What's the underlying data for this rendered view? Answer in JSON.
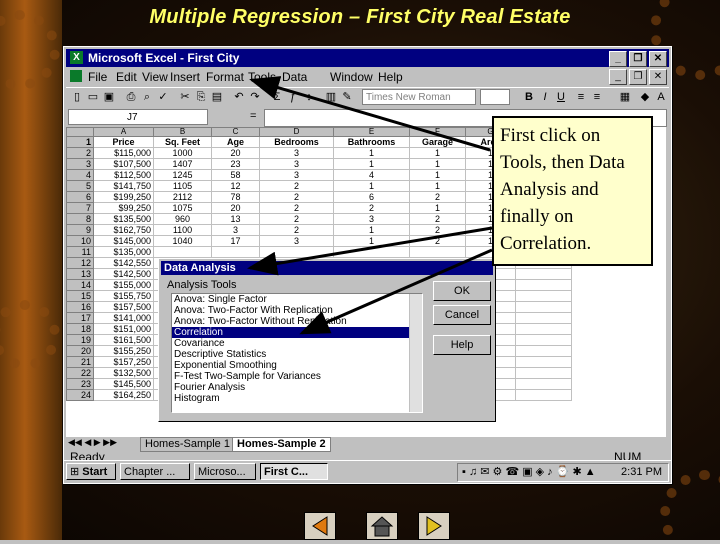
{
  "slide": {
    "title": "Multiple Regression –   First City Real Estate"
  },
  "excel": {
    "window_title": "Microsoft Excel - First City",
    "menu": [
      "File",
      "Edit",
      "View",
      "Insert",
      "Format",
      "Tools",
      "Data",
      "Window",
      "Help"
    ],
    "font_name": "Times New Roman",
    "cell_ref": "J7",
    "columns": [
      "A",
      "B",
      "C",
      "D",
      "E",
      "F",
      "G"
    ],
    "headers": [
      "Price",
      "Sq. Feet",
      "Age",
      "Bedrooms",
      "Bathrooms",
      "Garage",
      "Area"
    ],
    "rows": [
      [
        "$115,000",
        "1000",
        "20",
        "3",
        "1",
        "1",
        "1"
      ],
      [
        "$107,500",
        "1407",
        "23",
        "3",
        "1",
        "1",
        "1"
      ],
      [
        "$112,500",
        "1245",
        "58",
        "3",
        "4",
        "1",
        "1"
      ],
      [
        "$141,750",
        "1105",
        "12",
        "2",
        "1",
        "1",
        "1"
      ],
      [
        "$199,250",
        "2112",
        "78",
        "2",
        "6",
        "2",
        "1"
      ],
      [
        "$99,250",
        "1075",
        "20",
        "2",
        "2",
        "1",
        "1"
      ],
      [
        "$135,500",
        "960",
        "13",
        "2",
        "3",
        "2",
        "1"
      ],
      [
        "$162,750",
        "1100",
        "3",
        "2",
        "1",
        "2",
        "1"
      ],
      [
        "$145,000",
        "1040",
        "17",
        "3",
        "1",
        "2",
        "1"
      ],
      [
        "$135,000",
        "",
        "",
        "",
        "",
        "",
        ""
      ],
      [
        "$142,550",
        "",
        "",
        "",
        "",
        "",
        ""
      ],
      [
        "$142,500",
        "",
        "",
        "",
        "",
        "",
        ""
      ],
      [
        "$155,000",
        "",
        "",
        "",
        "",
        "",
        ""
      ],
      [
        "$155,750",
        "",
        "",
        "",
        "",
        "",
        ""
      ],
      [
        "$157,500",
        "",
        "",
        "",
        "",
        "",
        ""
      ],
      [
        "$141,000",
        "",
        "",
        "",
        "",
        "",
        ""
      ],
      [
        "$151,000",
        "",
        "",
        "",
        "",
        "",
        ""
      ],
      [
        "$161,500",
        "",
        "",
        "",
        "",
        "",
        ""
      ],
      [
        "$155,250",
        "",
        "",
        "",
        "",
        "",
        ""
      ],
      [
        "$157,250",
        "",
        "",
        "",
        "",
        "",
        ""
      ],
      [
        "$132,500",
        "",
        "",
        "",
        "",
        "",
        ""
      ],
      [
        "$145,500",
        "",
        "",
        "",
        "",
        "",
        ""
      ],
      [
        "$164,250",
        "",
        "",
        "",
        "",
        "",
        ""
      ]
    ],
    "sheet_tabs": [
      "Homes-Sample 1",
      "Homes-Sample 2"
    ],
    "status": "Ready",
    "num_indicator": "NUM"
  },
  "dialog": {
    "title": "Data Analysis",
    "label": "Analysis Tools",
    "items": [
      "Anova: Single Factor",
      "Anova: Two-Factor With Replication",
      "Anova: Two-Factor Without Replication",
      "Correlation",
      "Covariance",
      "Descriptive Statistics",
      "Exponential Smoothing",
      "F-Test Two-Sample for Variances",
      "Fourier Analysis",
      "Histogram"
    ],
    "selected_index": 3,
    "ok_label": "OK",
    "cancel_label": "Cancel",
    "help_label": "Help"
  },
  "taskbar": {
    "start_label": "Start",
    "buttons": [
      "Chapter ...",
      "Microso...",
      "First C..."
    ],
    "clock": "2:31 PM"
  },
  "callout": {
    "text": "First click on Tools, then Data Analysis and finally on Correlation."
  },
  "colors": {
    "title_text": "#ffff66",
    "window_title": "#000080",
    "callout_bg": "#ffffcc",
    "arrow": "#000000"
  }
}
